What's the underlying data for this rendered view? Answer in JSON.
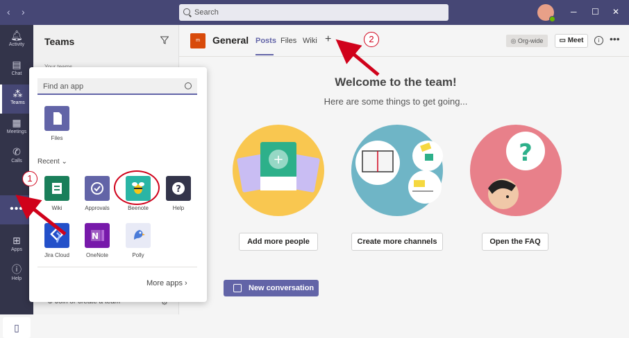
{
  "topbar": {
    "search_placeholder": "Search",
    "nav_back": "‹",
    "nav_forward": "›"
  },
  "rail": {
    "items": [
      {
        "label": "Activity"
      },
      {
        "label": "Chat"
      },
      {
        "label": "Teams"
      },
      {
        "label": "Meetings"
      },
      {
        "label": "Calls"
      },
      {
        "label": "Apps"
      },
      {
        "label": "Help"
      }
    ],
    "more": "•••"
  },
  "teams_panel": {
    "title": "Teams",
    "section": "Your teams",
    "join": "Join or create a team"
  },
  "channel": {
    "badge": "m",
    "name": "General",
    "tabs": [
      "Posts",
      "Files",
      "Wiki"
    ],
    "add_tab": "+",
    "orgwide": "Org-wide",
    "meet": "Meet"
  },
  "welcome": {
    "title": "Welcome to the team!",
    "subtitle": "Here are some things to get going...",
    "buttons": [
      "Add more people",
      "Create more channels",
      "Open the FAQ"
    ],
    "new_conversation": "New conversation"
  },
  "popup": {
    "search_placeholder": "Find an app",
    "pinned": [
      {
        "label": "Files",
        "color": "#6264a7"
      }
    ],
    "recent_label": "Recent",
    "apps": [
      {
        "label": "Wiki",
        "color": "#1a7f5a"
      },
      {
        "label": "Approvals",
        "color": "#6264a7"
      },
      {
        "label": "Beenote",
        "color": "#2ab5a5"
      },
      {
        "label": "Help",
        "color": "#33344a"
      },
      {
        "label": "Jira Cloud",
        "color": "#2350c9"
      },
      {
        "label": "OneNote",
        "color": "#7719aa"
      },
      {
        "label": "Polly",
        "color": "#e8eaf6"
      }
    ],
    "more_apps": "More apps"
  },
  "annotations": {
    "marker1": "1",
    "marker2": "2"
  },
  "colors": {
    "accent": "#6264a7",
    "topbar": "#464775",
    "rail": "#33344a",
    "annotation": "#d0021b"
  }
}
